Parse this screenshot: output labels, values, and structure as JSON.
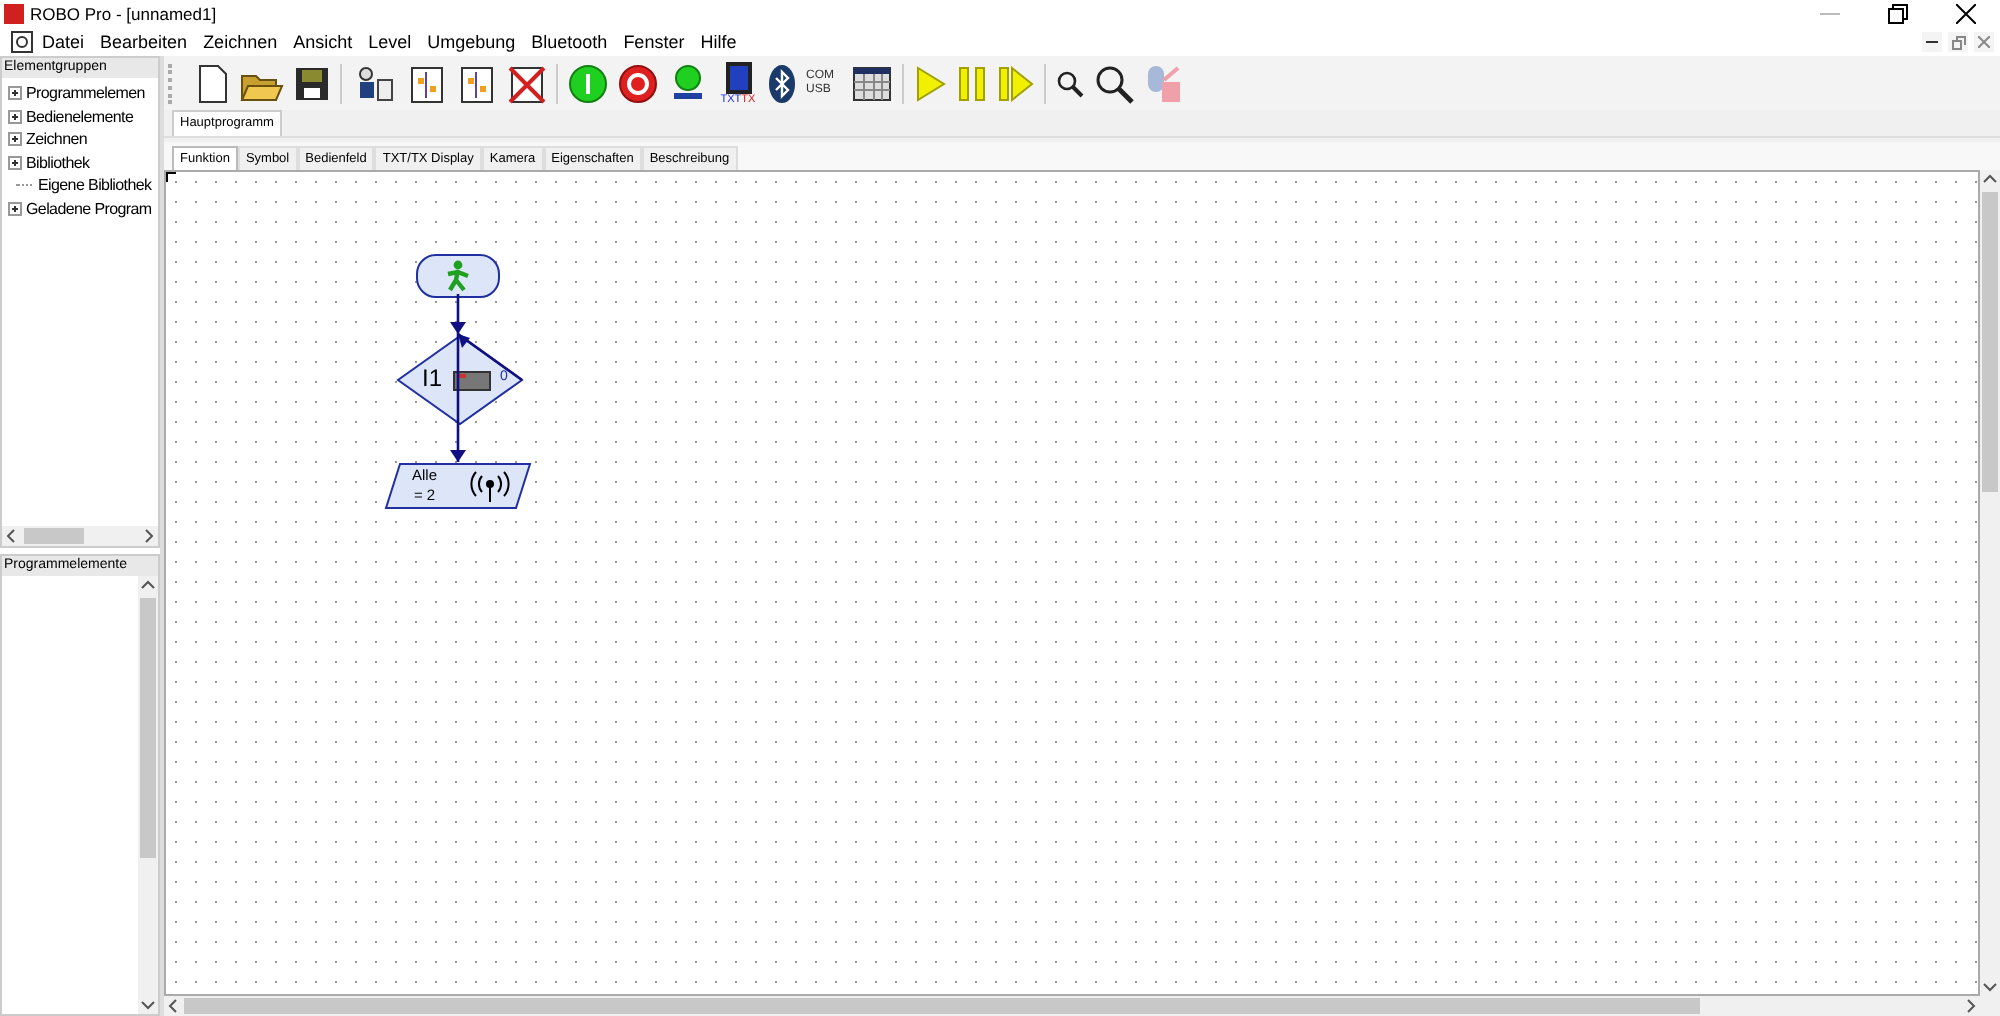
{
  "window": {
    "title": "ROBO Pro - [unnamed1]"
  },
  "menu": [
    "Datei",
    "Bearbeiten",
    "Zeichnen",
    "Ansicht",
    "Level",
    "Umgebung",
    "Bluetooth",
    "Fenster",
    "Hilfe"
  ],
  "toolbar": [
    {
      "kind": "new"
    },
    {
      "kind": "open"
    },
    {
      "kind": "save"
    },
    {
      "kind": "sep"
    },
    {
      "kind": "environment"
    },
    {
      "kind": "new-sub"
    },
    {
      "kind": "copy-sub"
    },
    {
      "kind": "delete-sub"
    },
    {
      "kind": "sep"
    },
    {
      "kind": "start"
    },
    {
      "kind": "stop"
    },
    {
      "kind": "download"
    },
    {
      "kind": "controller",
      "label": "TXT",
      "label2": "TX"
    },
    {
      "kind": "bluetooth"
    },
    {
      "kind": "port",
      "label": "COM",
      "label2": "USB"
    },
    {
      "kind": "panel"
    },
    {
      "kind": "sep"
    },
    {
      "kind": "play"
    },
    {
      "kind": "pause"
    },
    {
      "kind": "step"
    },
    {
      "kind": "sep"
    },
    {
      "kind": "zoom-small"
    },
    {
      "kind": "zoom-large"
    },
    {
      "kind": "disconnect"
    }
  ],
  "sidebar": {
    "title": "Elementgruppen",
    "items": [
      {
        "label": "Programmelemen",
        "expandable": true
      },
      {
        "label": "Bedienelemente",
        "expandable": true
      },
      {
        "label": "Zeichnen",
        "expandable": true
      },
      {
        "label": "Bibliothek",
        "expandable": true
      },
      {
        "label": "Eigene Bibliothek",
        "expandable": false
      },
      {
        "label": "Geladene Program",
        "expandable": true
      }
    ],
    "panel_title": "Programmelemente"
  },
  "program_tabs": [
    {
      "label": "Hauptprogramm",
      "selected": true
    }
  ],
  "view_tabs": [
    {
      "label": "Funktion",
      "selected": true
    },
    {
      "label": "Symbol",
      "selected": false
    },
    {
      "label": "Bedienfeld",
      "selected": false
    },
    {
      "label": "TXT/TX Display",
      "selected": false
    },
    {
      "label": "Kamera",
      "selected": false
    },
    {
      "label": "Eigenschaften",
      "selected": false
    },
    {
      "label": "Beschreibung",
      "selected": false
    }
  ],
  "flowchart": {
    "branch": {
      "input": "I1",
      "exit": "0"
    },
    "send": {
      "target": "Alle",
      "value": "= 2"
    }
  }
}
